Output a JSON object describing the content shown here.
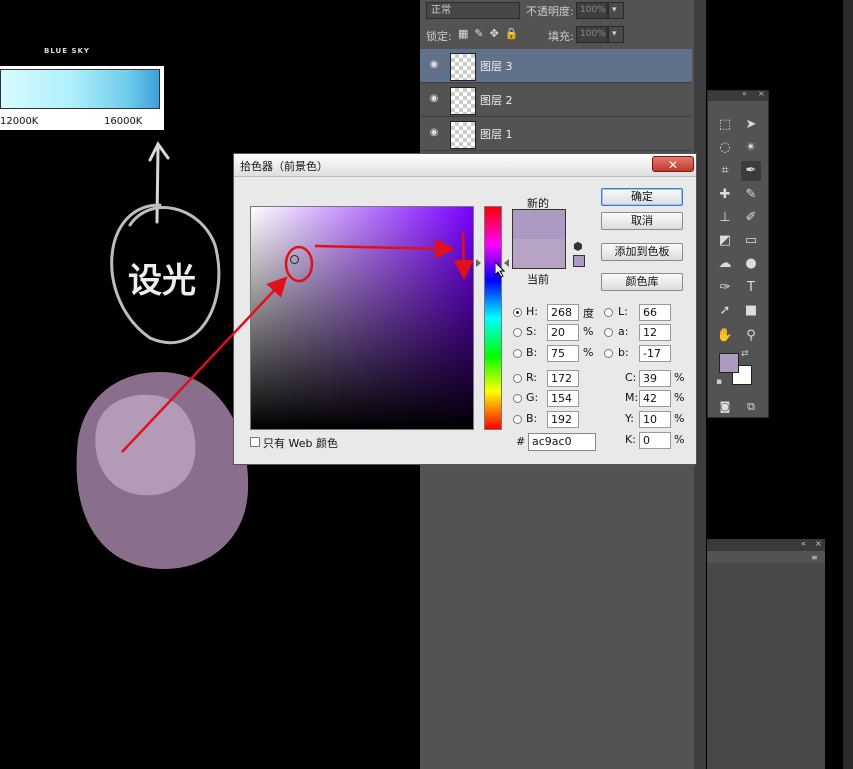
{
  "canvas": {
    "gradient_title": "BLUE SKY",
    "temp_left": "12000K",
    "temp_right": "16000K",
    "handwriting": "设光",
    "blob_outer_color": "#8a6f8c",
    "blob_inner_color": "#b39bb8"
  },
  "layers_panel": {
    "blend_mode": "正常",
    "opacity_label": "不透明度:",
    "opacity_value": "100%",
    "lock_label": "锁定:",
    "fill_label": "填充:",
    "fill_value": "100%",
    "layers": [
      {
        "name": "图层 3",
        "selected": true,
        "icon": "eye-icon"
      },
      {
        "name": "图层 2",
        "selected": false,
        "icon": "eye-icon"
      },
      {
        "name": "图层 1",
        "selected": false,
        "icon": "eye-icon"
      }
    ]
  },
  "color_picker": {
    "title": "拾色器（前景色）",
    "close_icon": "close-icon",
    "new_label": "新的",
    "current_label": "当前",
    "new_color": "#ac9ac0",
    "current_color": "#b7a3c3",
    "buttons": {
      "ok": "确定",
      "cancel": "取消",
      "add_swatch": "添加到色板",
      "libraries": "颜色库"
    },
    "hsb": {
      "h_label": "H:",
      "h": "268",
      "h_unit": "度",
      "s_label": "S:",
      "s": "20",
      "s_unit": "%",
      "b_label": "B:",
      "b": "75",
      "b_unit": "%",
      "selected": "H"
    },
    "rgb": {
      "r_label": "R:",
      "r": "172",
      "g_label": "G:",
      "g": "154",
      "b_label": "B:",
      "b": "192"
    },
    "lab": {
      "l_label": "L:",
      "l": "66",
      "a_label": "a:",
      "a": "12",
      "b_label": "b:",
      "b": "-17"
    },
    "cmyk": {
      "c_label": "C:",
      "c": "39",
      "m_label": "M:",
      "m": "42",
      "y_label": "Y:",
      "y": "10",
      "k_label": "K:",
      "k": "0",
      "unit": "%"
    },
    "web_only_label": "只有 Web 颜色",
    "hex_label": "#",
    "hex": "ac9ac0"
  },
  "toolbar": {
    "tools": [
      "marquee-icon",
      "move-icon",
      "lasso-icon",
      "magic-wand-icon",
      "crop-icon",
      "eyedropper-icon",
      "healing-icon",
      "brush-icon",
      "stamp-icon",
      "history-brush-icon",
      "eraser-icon",
      "gradient-icon",
      "blur-icon",
      "dodge-icon",
      "pen-icon",
      "type-icon",
      "path-select-icon",
      "shape-icon",
      "hand-icon",
      "zoom-icon"
    ],
    "text_tool_glyph": "T",
    "foreground_color": "#ac9ac0",
    "background_color": "#ffffff"
  },
  "annotation_color": "#e0101a"
}
